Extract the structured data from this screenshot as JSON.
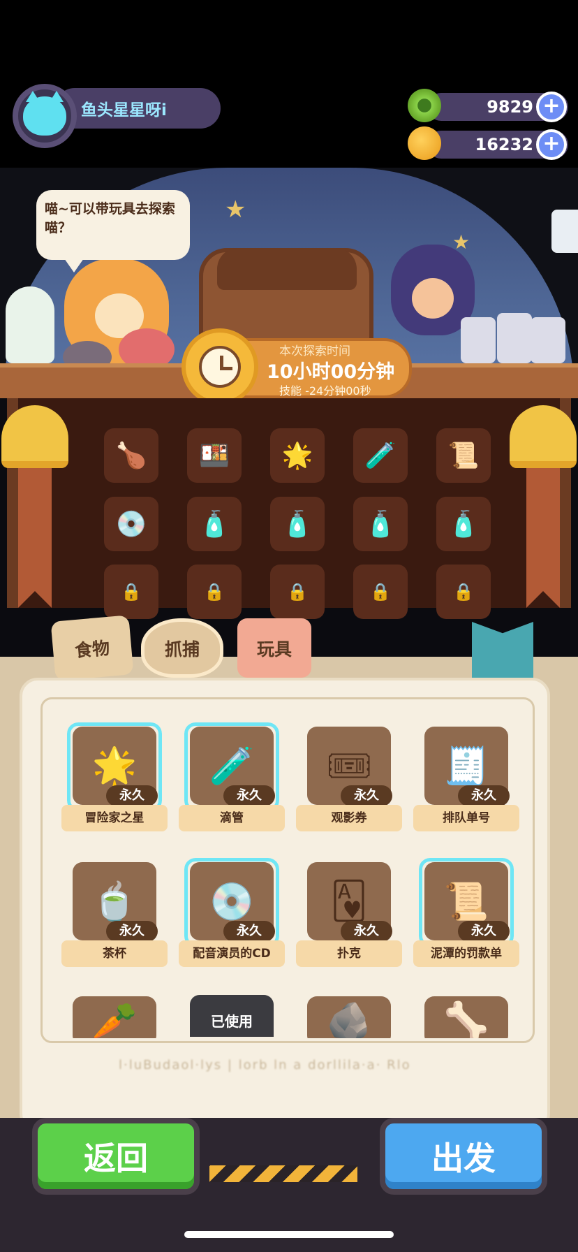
{
  "player": {
    "name": "鱼头星星呀i"
  },
  "currencies": [
    {
      "icon": "green-donut-coin-icon",
      "value": "9829"
    },
    {
      "icon": "gold-planet-coin-icon",
      "value": "16232"
    }
  ],
  "plus_symbol": "+",
  "speech_bubble": "喵~可以带玩具去探索喵？",
  "explore_timer": {
    "title": "本次探索时间",
    "duration": "10小时00分钟",
    "skill_bonus": "技能 -24分钟00秒"
  },
  "selected_slots": [
    {
      "icon": "food-bucket-icon",
      "glyph": "🍗"
    },
    {
      "icon": "bento-box-icon",
      "glyph": "🍱"
    },
    {
      "icon": "adventurer-star-icon",
      "glyph": "🌟"
    },
    {
      "icon": "dropper-icon",
      "glyph": "🧪"
    },
    {
      "icon": "fine-ticket-icon",
      "glyph": "📜"
    },
    {
      "icon": "cd-icon",
      "glyph": "💿"
    },
    {
      "icon": "potion-bottle-icon",
      "glyph": "🧴"
    },
    {
      "icon": "potion-bottle-icon",
      "glyph": "🧴"
    },
    {
      "icon": "potion-bottle-icon",
      "glyph": "🧴"
    },
    {
      "icon": "potion-bottle-icon",
      "glyph": "🧴"
    }
  ],
  "locked_slot_glyph": "🔒",
  "tabs": {
    "food": "食物",
    "catch": "抓捕",
    "toy": "玩具"
  },
  "inventory": {
    "items": [
      {
        "name": "冒险家之星",
        "badge": "永久",
        "glyph": "🌟",
        "selected": true
      },
      {
        "name": "滴管",
        "badge": "永久",
        "glyph": "🧪",
        "selected": true
      },
      {
        "name": "观影券",
        "badge": "永久",
        "glyph": "🎟",
        "selected": false
      },
      {
        "name": "排队单号",
        "badge": "永久",
        "glyph": "🧾",
        "selected": false
      },
      {
        "name": "茶杯",
        "badge": "永久",
        "glyph": "🍵",
        "selected": false
      },
      {
        "name": "配音演员的CD",
        "badge": "永久",
        "glyph": "💿",
        "selected": true
      },
      {
        "name": "扑克",
        "badge": "永久",
        "glyph": "🂱",
        "selected": false
      },
      {
        "name": "泥潭的罚款单",
        "badge": "永久",
        "glyph": "📜",
        "selected": true
      }
    ],
    "partial_row": [
      {
        "glyph": "🥕"
      },
      {
        "glyph": "",
        "status": "已使用"
      },
      {
        "glyph": "🪨"
      },
      {
        "glyph": "🦴"
      }
    ],
    "footer_text": "l·luBudaol·lys  |  lorb ln a dorllila·a·  Rlo"
  },
  "buttons": {
    "back": "返回",
    "go": "出发"
  },
  "colors": {
    "accent_green": "#5cd04a",
    "accent_blue": "#4da8f0",
    "hud_pill": "#4a3f66",
    "select_glow": "#6fe6f5"
  }
}
